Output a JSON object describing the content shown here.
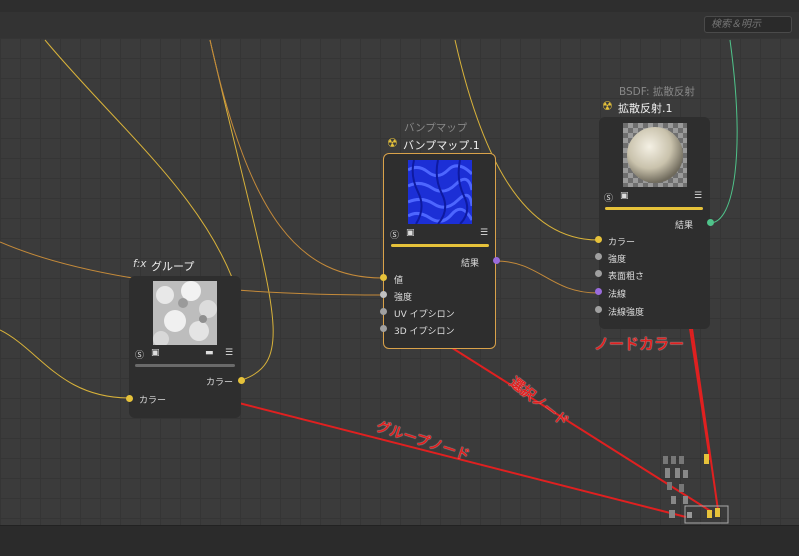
{
  "search": {
    "placeholder": "検索＆明示"
  },
  "nodes": {
    "group": {
      "prefix": "f:x",
      "title": "グループ",
      "output_port": "カラー",
      "input_port": "カラー"
    },
    "bump": {
      "subtitle": "バンプマップ",
      "title": "バンプマップ.1",
      "output_port": "結果",
      "inputs": [
        "値",
        "強度",
        "UV イプシロン",
        "3D イプシロン"
      ]
    },
    "diffuse": {
      "subtitle": "BSDF: 拡散反射",
      "title": "拡散反射.1",
      "output_port": "結果",
      "inputs": [
        "カラー",
        "強度",
        "表面粗さ",
        "法線",
        "法線強度"
      ]
    }
  },
  "annotations": {
    "node_color": "ノードカラー",
    "selected_node": "選択ノード",
    "group_node": "グループノード"
  },
  "colors": {
    "wire_yellow": "#d8b23a",
    "wire_orange": "#c48a3a",
    "wire_green": "#4fc38a",
    "port_yellow": "#e6c23a",
    "port_purple": "#9a6bdc",
    "port_gray": "#a0a0a0",
    "selected_border": "#d9a24a",
    "annotation": "#e02020"
  }
}
